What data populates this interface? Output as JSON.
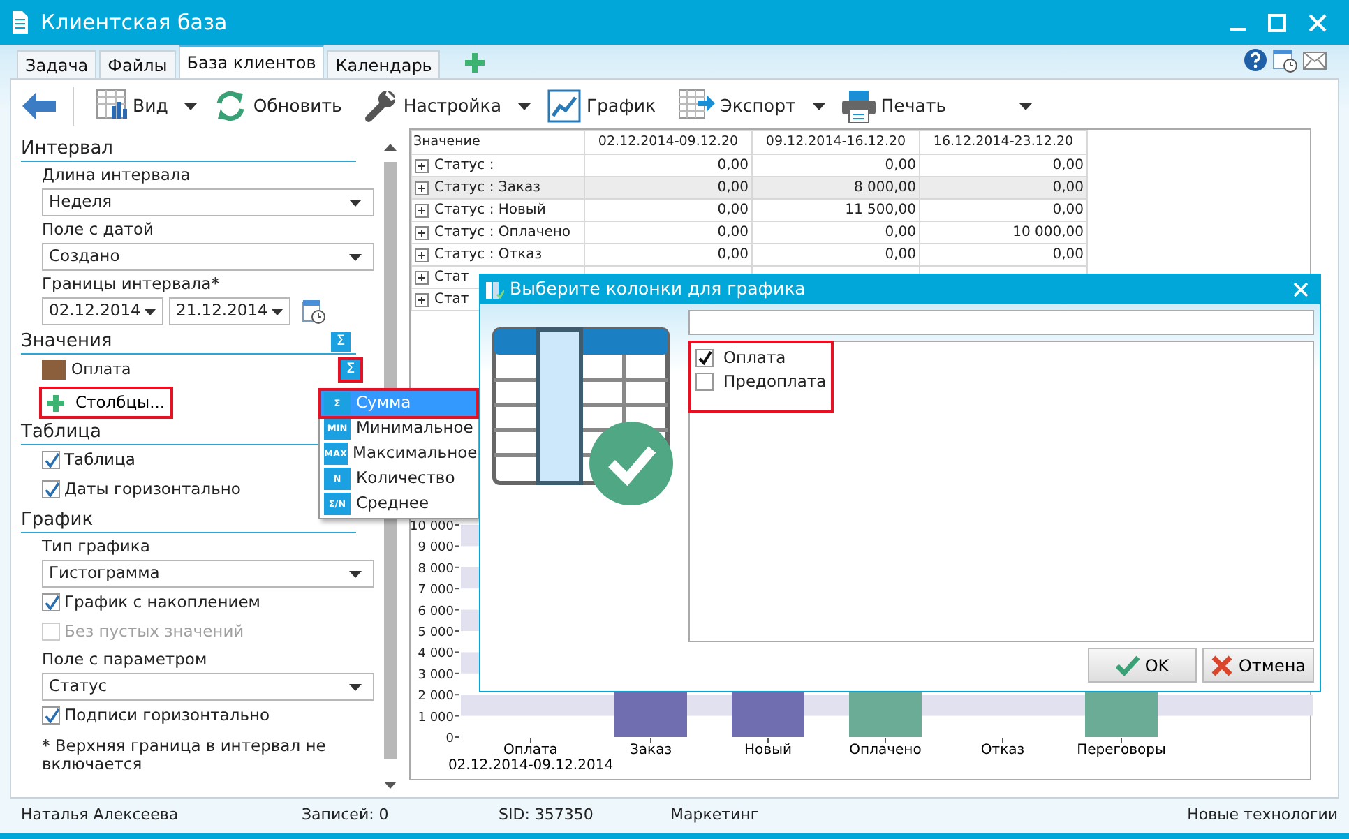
{
  "window": {
    "title": "Клиентская база"
  },
  "tabs": [
    {
      "label": "Задача",
      "selected": false
    },
    {
      "label": "Файлы",
      "selected": false
    },
    {
      "label": "База клиентов",
      "selected": true
    },
    {
      "label": "Календарь",
      "selected": false
    }
  ],
  "toolbar": [
    {
      "label": "Вид",
      "dropdown": true
    },
    {
      "label": "Обновить",
      "dropdown": false
    },
    {
      "label": "Настройка",
      "dropdown": true
    },
    {
      "label": "График",
      "dropdown": false
    },
    {
      "label": "Экспорт",
      "dropdown": true
    },
    {
      "label": "Печать",
      "dropdown": true
    }
  ],
  "left_panel": {
    "sections": [
      {
        "title": "Интервал",
        "items": [
          {
            "kind": "label",
            "text": "Длина интервала"
          },
          {
            "kind": "select",
            "value": "Неделя"
          },
          {
            "kind": "label",
            "text": "Поле с датой"
          },
          {
            "kind": "select",
            "value": "Создано"
          },
          {
            "kind": "label",
            "text": "Границы интервала*"
          },
          {
            "kind": "date_range",
            "from": "02.12.2014",
            "to": "21.12.2014"
          }
        ]
      },
      {
        "title": "Значения",
        "aggregate": "Σ",
        "items": [
          {
            "kind": "value_row",
            "label": "Оплата",
            "color": "#8b5e3c",
            "aggregate": "Σ",
            "highlighted": true
          },
          {
            "kind": "add_button",
            "label": "Столбцы...",
            "highlighted": true
          }
        ]
      },
      {
        "title": "Таблица",
        "items": [
          {
            "kind": "checkbox",
            "label": "Таблица",
            "checked": true,
            "disabled": false
          },
          {
            "kind": "checkbox",
            "label": "Даты горизонтально",
            "checked": true,
            "disabled": false
          }
        ]
      },
      {
        "title": "График",
        "items": [
          {
            "kind": "label",
            "text": "Тип графика"
          },
          {
            "kind": "select",
            "value": "Гистограмма"
          },
          {
            "kind": "checkbox",
            "label": "График с накоплением",
            "checked": true,
            "disabled": false
          },
          {
            "kind": "checkbox",
            "label": "Без пустых значений",
            "checked": false,
            "disabled": true
          },
          {
            "kind": "label",
            "text": "Поле с параметром"
          },
          {
            "kind": "select",
            "value": "Статус"
          },
          {
            "kind": "checkbox",
            "label": "Подписи горизонтально",
            "checked": true,
            "disabled": false
          },
          {
            "kind": "note",
            "text": "* Верхняя граница в интервал не включается"
          }
        ]
      }
    ]
  },
  "table": {
    "columns": [
      "Значение",
      "02.12.2014-09.12.20",
      "09.12.2014-16.12.20",
      "16.12.2014-23.12.20"
    ],
    "rows": [
      {
        "label": "Статус :",
        "values": [
          "0,00",
          "0,00",
          "0,00"
        ],
        "selected": false
      },
      {
        "label": "Статус : Заказ",
        "values": [
          "0,00",
          "8 000,00",
          "0,00"
        ],
        "selected": true
      },
      {
        "label": "Статус : Новый",
        "values": [
          "0,00",
          "11 500,00",
          "0,00"
        ],
        "selected": false
      },
      {
        "label": "Статус : Оплачено",
        "values": [
          "0,00",
          "0,00",
          "10 000,00"
        ],
        "selected": false
      },
      {
        "label": "Статус : Отказ",
        "values": [
          "0,00",
          "0,00",
          "0,00"
        ],
        "selected": false
      },
      {
        "label": "Стат",
        "selected": false
      },
      {
        "label": "Стат",
        "selected": false
      }
    ]
  },
  "chart": {
    "y_ticks": [
      "10 000",
      "9 000",
      "8 000",
      "7 000",
      "6 000",
      "5 000",
      "4 000",
      "3 000",
      "2 000",
      "1 000",
      "0"
    ],
    "categories": [
      {
        "label": "Оплата",
        "sublabel": "02.12.2014-09.12.2014"
      },
      {
        "label": "Заказ",
        "color": "#706eb0"
      },
      {
        "label": "Новый",
        "color": "#706eb0"
      },
      {
        "label": "Оплачено",
        "color": "#6aac95"
      },
      {
        "label": "Отказ"
      },
      {
        "label": "Переговоры",
        "color": "#6aac95"
      }
    ]
  },
  "aggregate_menu": {
    "items": [
      {
        "icon": "Σ",
        "label": "Сумма",
        "selected": true,
        "highlighted": true
      },
      {
        "icon": "MIN",
        "label": "Минимальное",
        "selected": false,
        "highlighted": false
      },
      {
        "icon": "MAX",
        "label": "Максимальное",
        "selected": false,
        "highlighted": false
      },
      {
        "icon": "N",
        "label": "Количество",
        "selected": false,
        "highlighted": false
      },
      {
        "icon": "Σ/N",
        "label": "Среднее",
        "selected": false,
        "highlighted": false
      }
    ]
  },
  "dialog": {
    "title": "Выберите колонки для графика",
    "highlighted": true,
    "columns": [
      {
        "label": "Оплата",
        "checked": true
      },
      {
        "label": "Предоплата",
        "checked": false
      }
    ],
    "buttons": [
      {
        "kind": "ok",
        "label": "OK"
      },
      {
        "kind": "cancel",
        "label": "Отмена"
      }
    ]
  },
  "status_bar": [
    "Наталья Алексеева",
    "Записей: 0",
    "SID: 357350",
    "Маркетинг",
    "Новые технологии"
  ]
}
